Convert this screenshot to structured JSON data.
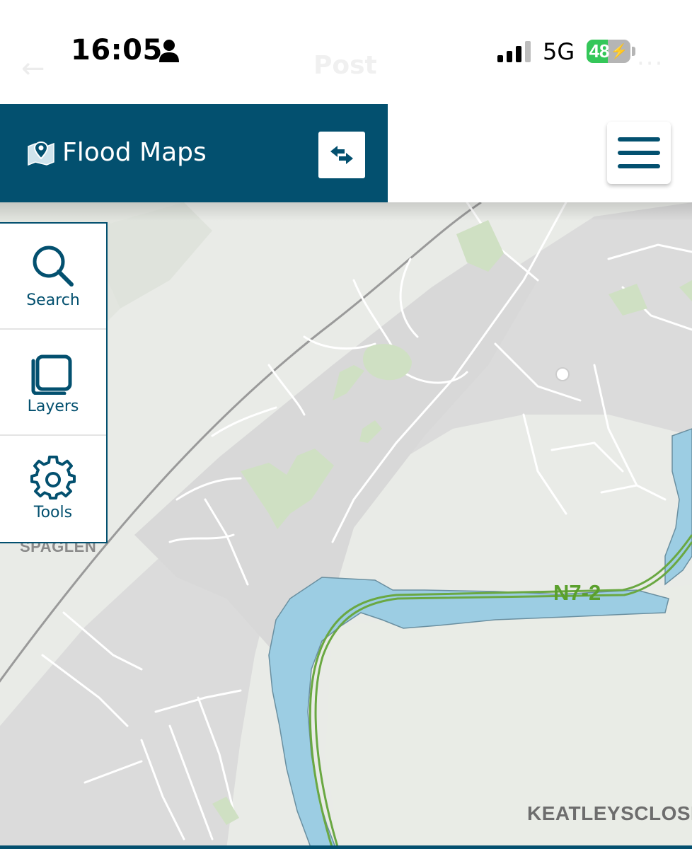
{
  "status_bar": {
    "time": "16:05",
    "network": "5G",
    "battery_level": "48",
    "battery_fraction": 0.48,
    "behind_title": "Post"
  },
  "header": {
    "title": "Flood Maps",
    "brand_color": "#03506f"
  },
  "tools": [
    {
      "label": "Search",
      "icon": "search-icon"
    },
    {
      "label": "Layers",
      "icon": "layers-icon"
    },
    {
      "label": "Tools",
      "icon": "gear-icon"
    }
  ],
  "map": {
    "place_labels": [
      "SPAGLEN",
      "KEATLEYSCLOSE"
    ],
    "road_label": "N7-2",
    "colors": {
      "water": "#9ccde3",
      "land": "#e9ebe7",
      "urban": "#dbdbdb",
      "park": "#cfe0c3",
      "road": "#6aa842"
    }
  }
}
